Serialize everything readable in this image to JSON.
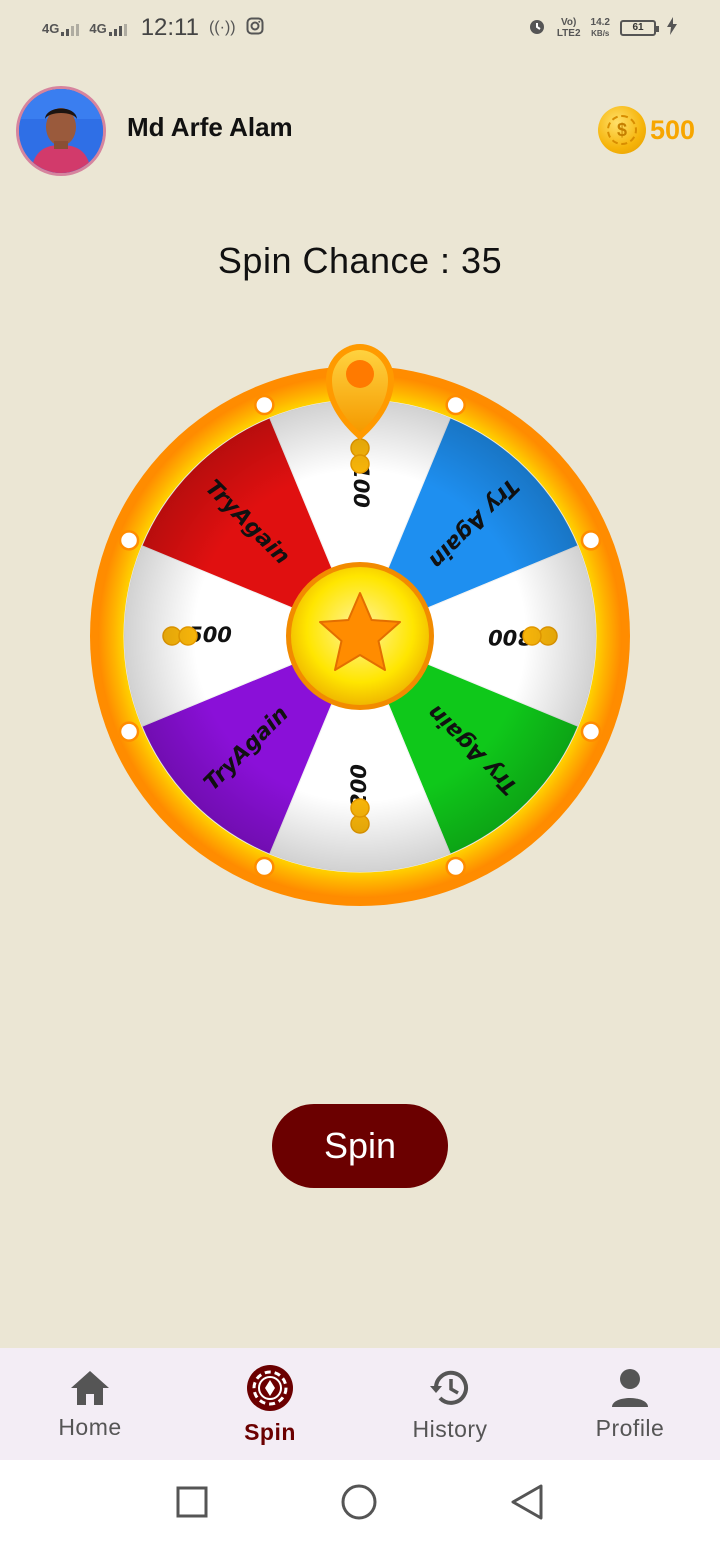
{
  "status_bar": {
    "net1": "4G",
    "net2": "4G",
    "time": "12:11",
    "volte_top": "Vo)",
    "volte_bottom": "LTE2",
    "speed_top": "14.2",
    "speed_bottom": "KB/s",
    "battery": "61"
  },
  "header": {
    "user_name": "Md Arfe Alam",
    "coins": "500",
    "coin_symbol": "$"
  },
  "spin_chance": "Spin Chance : 35",
  "wheel": {
    "segments": [
      {
        "label": "100",
        "color": "#ffffff",
        "coin": true
      },
      {
        "label": "Try Again",
        "color": "#1e8ff0"
      },
      {
        "label": "300",
        "color": "#ffffff",
        "coin": true
      },
      {
        "label": "Try Again",
        "color": "#0fc81a"
      },
      {
        "label": "200",
        "color": "#ffffff",
        "coin": true
      },
      {
        "label": "TryAgain",
        "color": "#8a10d8"
      },
      {
        "label": "500",
        "color": "#ffffff",
        "coin": true
      },
      {
        "label": "TryAgain",
        "color": "#e01010"
      }
    ]
  },
  "spin_button": "Spin",
  "nav": [
    {
      "label": "Home",
      "icon": "home-icon"
    },
    {
      "label": "Spin",
      "icon": "spin-icon"
    },
    {
      "label": "History",
      "icon": "history-icon"
    },
    {
      "label": "Profile",
      "icon": "person-icon"
    }
  ],
  "colors": {
    "background": "#ebe6d4",
    "accent": "#6b0000",
    "coin": "#f7a600"
  }
}
